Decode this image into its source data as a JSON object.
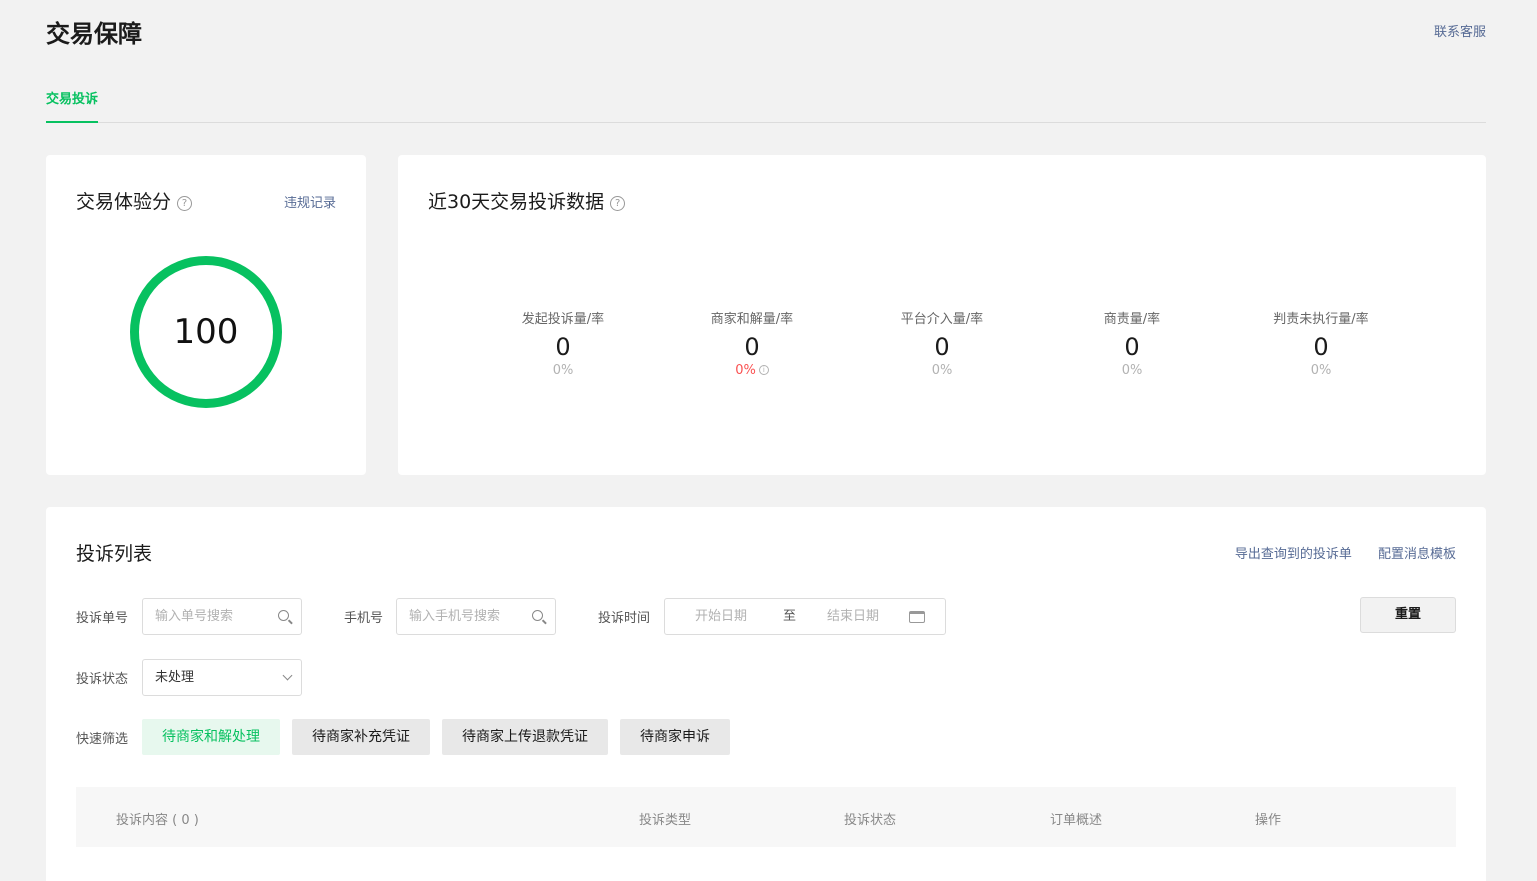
{
  "header": {
    "title": "交易保障",
    "contact": "联系客服"
  },
  "tabs": [
    {
      "label": "交易投诉",
      "active": true
    }
  ],
  "score_card": {
    "title": "交易体验分",
    "help_glyph": "?",
    "violation_link": "违规记录",
    "score": "100"
  },
  "stats_card": {
    "title": "近30天交易投诉数据",
    "help_glyph": "?",
    "items": [
      {
        "label": "发起投诉量/率",
        "count": "0",
        "rate": "0%"
      },
      {
        "label": "商家和解量/率",
        "count": "0",
        "rate": "0%"
      },
      {
        "label": "平台介入量/率",
        "count": "0",
        "rate": "0%"
      },
      {
        "label": "商责量/率",
        "count": "0",
        "rate": "0%"
      },
      {
        "label": "判责未执行量/率",
        "count": "0",
        "rate": "0%"
      }
    ]
  },
  "list_card": {
    "title": "投诉列表",
    "actions": {
      "export": "导出查询到的投诉单",
      "config": "配置消息模板"
    },
    "filters": {
      "order_no_label": "投诉单号",
      "order_no_placeholder": "输入单号搜索",
      "phone_label": "手机号",
      "phone_placeholder": "输入手机号搜索",
      "time_label": "投诉时间",
      "date_start": "开始日期",
      "date_to": "至",
      "date_end": "结束日期",
      "status_label": "投诉状态",
      "status_value": "未处理",
      "quick_label": "快速筛选",
      "reset": "重置"
    },
    "quick_filters": [
      "待商家和解处理",
      "待商家补充凭证",
      "待商家上传退款凭证",
      "待商家申诉"
    ],
    "table_headers": [
      "投诉内容 ( 0 )",
      "投诉类型",
      "投诉状态",
      "订单概述",
      "操作"
    ]
  },
  "colors": {
    "accent": "#07c160",
    "link": "#576b95",
    "alert": "#fa5151"
  },
  "icons": [
    "help-icon",
    "search-icon",
    "calendar-icon",
    "chevron-down-icon",
    "info-icon"
  ]
}
